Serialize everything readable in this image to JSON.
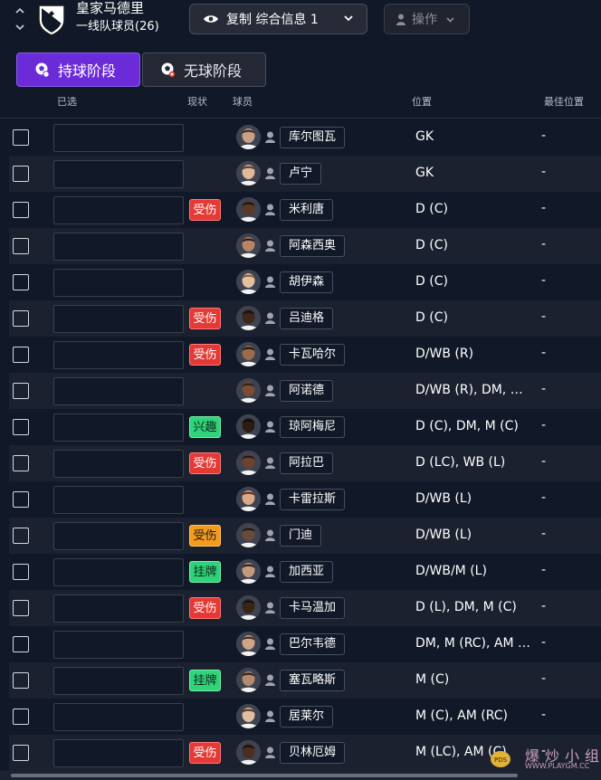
{
  "topbar": {
    "team_name": "皇家马德里",
    "squad_label": "一线队球员(26)",
    "view_select_label": "复制 综合信息 1",
    "action_label": "操作"
  },
  "tabs": [
    {
      "label": "持球阶段",
      "active": true
    },
    {
      "label": "无球阶段",
      "active": false
    }
  ],
  "columns": {
    "selected": "已选",
    "status": "现状",
    "player": "球员",
    "position": "位置",
    "best_position": "最佳位置"
  },
  "colors": {
    "accent": "#6c2bd9",
    "injured": "#e53935",
    "minor_injury": "#f29b1d",
    "interest": "#2fd37a",
    "listed": "#2fd37a",
    "background": "#111827",
    "row_alt": "#1c2130"
  },
  "players": [
    {
      "name": "库尔图瓦",
      "position": "GK",
      "best": "-",
      "status": "",
      "status_type": ""
    },
    {
      "name": "卢宁",
      "position": "GK",
      "best": "-",
      "status": "",
      "status_type": ""
    },
    {
      "name": "米利唐",
      "position": "D (C)",
      "best": "-",
      "status": "受伤",
      "status_type": "red"
    },
    {
      "name": "阿森西奥",
      "position": "D (C)",
      "best": "-",
      "status": "",
      "status_type": ""
    },
    {
      "name": "胡伊森",
      "position": "D (C)",
      "best": "-",
      "status": "",
      "status_type": ""
    },
    {
      "name": "吕迪格",
      "position": "D (C)",
      "best": "-",
      "status": "受伤",
      "status_type": "red"
    },
    {
      "name": "卡瓦哈尔",
      "position": "D/WB (R)",
      "best": "-",
      "status": "受伤",
      "status_type": "red"
    },
    {
      "name": "阿诺德",
      "position": "D/WB (R), DM, M (…",
      "best": "-",
      "status": "",
      "status_type": ""
    },
    {
      "name": "琼阿梅尼",
      "position": "D (C), DM, M (C)",
      "best": "-",
      "status": "兴趣",
      "status_type": "green"
    },
    {
      "name": "阿拉巴",
      "position": "D (LC), WB (L)",
      "best": "-",
      "status": "受伤",
      "status_type": "red"
    },
    {
      "name": "卡雷拉斯",
      "position": "D/WB (L)",
      "best": "-",
      "status": "",
      "status_type": ""
    },
    {
      "name": "门迪",
      "position": "D/WB (L)",
      "best": "-",
      "status": "受伤",
      "status_type": "orange"
    },
    {
      "name": "加西亚",
      "position": "D/WB/M (L)",
      "best": "-",
      "status": "挂牌",
      "status_type": "green"
    },
    {
      "name": "卡马温加",
      "position": "D (L), DM, M (C)",
      "best": "-",
      "status": "受伤",
      "status_type": "red"
    },
    {
      "name": "巴尔韦德",
      "position": "DM, M (RC), AM (R)",
      "best": "-",
      "status": "",
      "status_type": ""
    },
    {
      "name": "塞瓦略斯",
      "position": "M (C)",
      "best": "-",
      "status": "挂牌",
      "status_type": "green"
    },
    {
      "name": "居莱尔",
      "position": "M (C), AM (RC)",
      "best": "-",
      "status": "",
      "status_type": ""
    },
    {
      "name": "贝林厄姆",
      "position": "M (LC), AM (C)",
      "best": "-",
      "status": "受伤",
      "status_type": "red"
    }
  ],
  "watermark": {
    "main": "爆炒小组",
    "url": "WWW.PLAYGM.CC"
  }
}
